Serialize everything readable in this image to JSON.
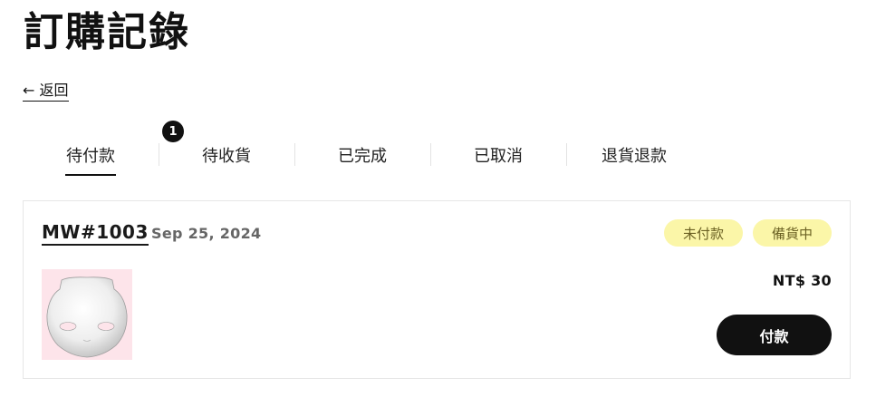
{
  "page": {
    "title": "訂購記錄",
    "back_label": "← 返回"
  },
  "tabs": [
    {
      "label": "待付款",
      "active": true,
      "badge": "1"
    },
    {
      "label": "待收貨",
      "active": false
    },
    {
      "label": "已完成",
      "active": false
    },
    {
      "label": "已取消",
      "active": false
    },
    {
      "label": "退貨退款",
      "active": false
    }
  ],
  "order": {
    "id": "MW#1003",
    "date": "Sep 25, 2024",
    "statuses": [
      "未付款",
      "備貨中"
    ],
    "price": "NT$ 30",
    "pay_label": "付款",
    "thumbnail_icon": "doll-face-mask-image"
  },
  "colors": {
    "status_badge_bg": "#fbf6a8",
    "status_badge_text": "#6b6123",
    "thumbnail_bg": "#fde4ea",
    "primary_button": "#111111"
  }
}
